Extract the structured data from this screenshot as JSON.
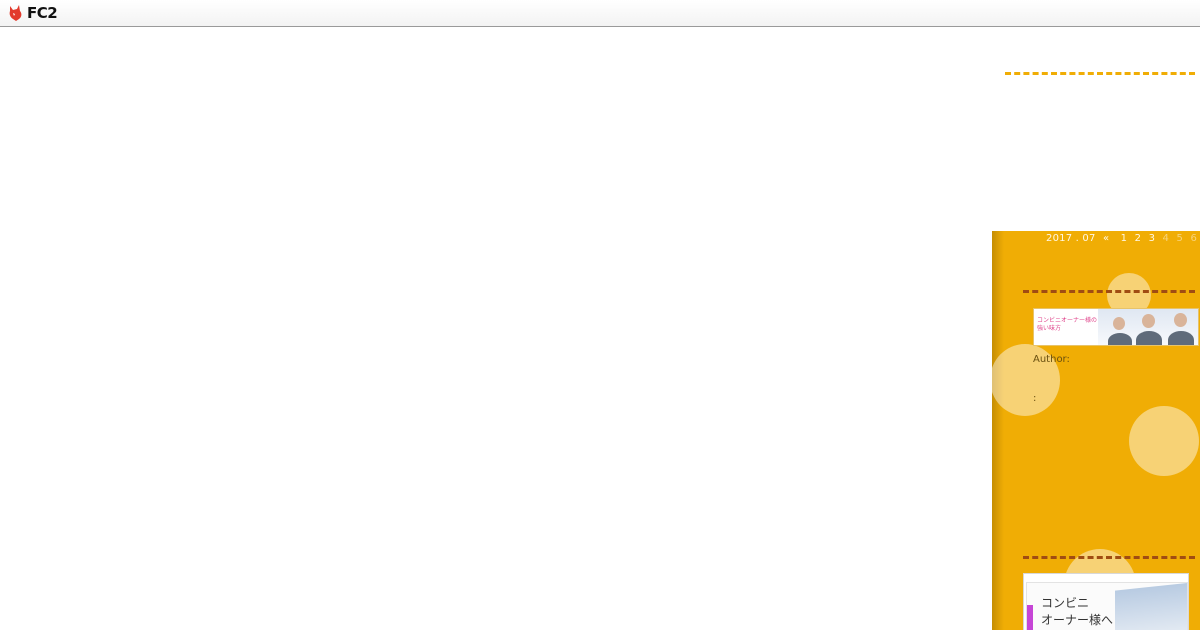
{
  "header": {
    "logo_text": "FC2",
    "logo_icon": "fc2-fox-icon"
  },
  "calendar": {
    "month": "2017 . 07",
    "prev": "«",
    "days": [
      "1",
      "2",
      "3",
      "4",
      "5",
      "6"
    ]
  },
  "profile": {
    "banner_text": "コンビニオーナー様の\n強い味方",
    "author_label": "Author:",
    "colon_text": ":"
  },
  "banner2": {
    "line1": "コンビニ",
    "line2": "オーナー様へ"
  },
  "colors": {
    "sidebar": "#f0ad05",
    "dash_light": "#f0ad05",
    "dash_dark": "#a04c12"
  }
}
